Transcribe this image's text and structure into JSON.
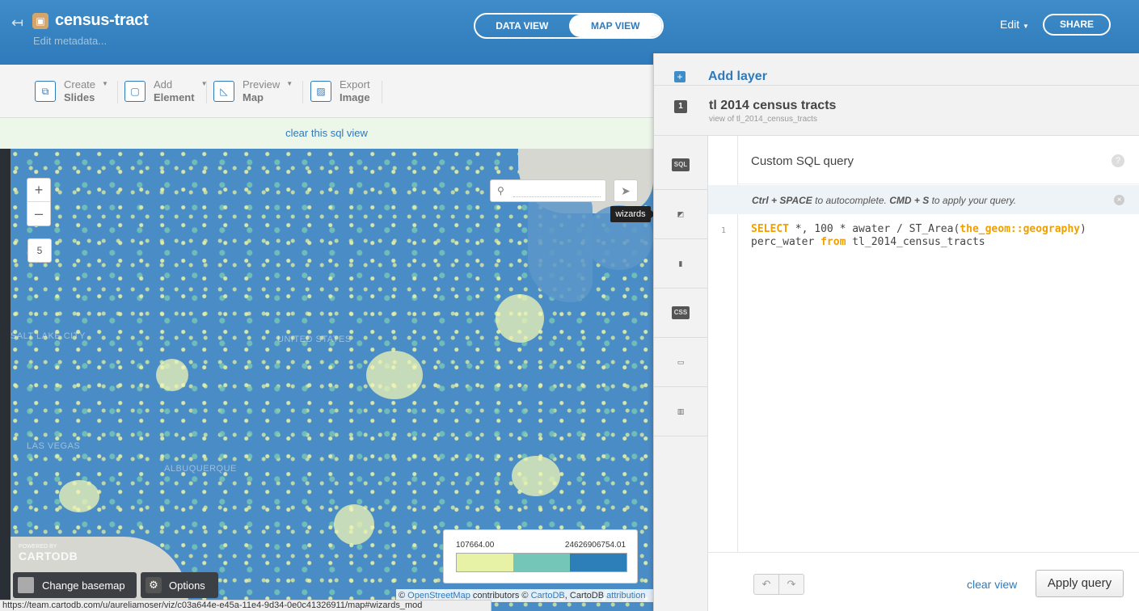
{
  "header": {
    "title": "census-tract",
    "subtitle": "Edit metadata...",
    "tabs": [
      "DATA VIEW",
      "MAP VIEW"
    ],
    "active_tab": "MAP VIEW",
    "edit_label": "Edit",
    "share_label": "SHARE"
  },
  "toolbar": {
    "items": [
      {
        "line1": "Create",
        "line2": "Slides",
        "icon": "slides-icon"
      },
      {
        "line1": "Add",
        "line2": "Element",
        "icon": "element-icon"
      },
      {
        "line1": "Preview",
        "line2": "Map",
        "icon": "preview-icon"
      },
      {
        "line1": "Export",
        "line2": "Image",
        "icon": "image-icon"
      }
    ]
  },
  "sql_notice": "clear this sql view",
  "map": {
    "zoom_in": "+",
    "zoom_out": "–",
    "zoom_level": "5",
    "search_placeholder": "",
    "tooltip": "wizards",
    "labels": [
      "SALT LAKE CITY",
      "UNITED STATES",
      "LAS VEGAS",
      "ALBUQUERQUE"
    ],
    "legend": {
      "min": "107664.00",
      "max": "24626906754.01",
      "colors": [
        "#e7f2a6",
        "#74c7b8",
        "#2c7fb8"
      ]
    },
    "powered_by": "POWERED BY",
    "brand": "CARTODB",
    "basemap_button": "Change basemap",
    "options_button": "Options",
    "attribution": {
      "prefix": "©",
      "osm": "OpenStreetMap",
      "middle": "contributors ©",
      "cartodb": "CartoDB",
      "sep": ", CartoDB",
      "attr": "attribution"
    },
    "status_url": "https://team.cartodb.com/u/aureliamoser/viz/c03a644e-e45a-11e4-9d34-0e0c41326911/map#wizards_mod"
  },
  "panel": {
    "add_layer": "Add layer",
    "layer_number": "1",
    "layer_name": "tl 2014 census tracts",
    "layer_sub": "view of tl_2014_census_tracts",
    "tabs": [
      "SQL",
      "wizard",
      "infowindow",
      "CSS",
      "legend",
      "filters"
    ],
    "editor": {
      "title": "Custom SQL query",
      "help": "?",
      "hint_ctrl": "Ctrl + SPACE",
      "hint_mid": "to autocomplete.",
      "hint_cmd": "CMD + S",
      "hint_end": "to apply your query.",
      "line_no": "1",
      "kw_select": "SELECT",
      "code1": " *, 100 * awater / ST_Area(",
      "kw_geom": "the_geom::geography",
      "code1_end": ")",
      "code2_start": "perc_water ",
      "kw_from": "from",
      "code2_end": " tl_2014_census_tracts",
      "undo": "↶",
      "redo": "↷",
      "clear_view": "clear view",
      "apply": "Apply query"
    }
  }
}
